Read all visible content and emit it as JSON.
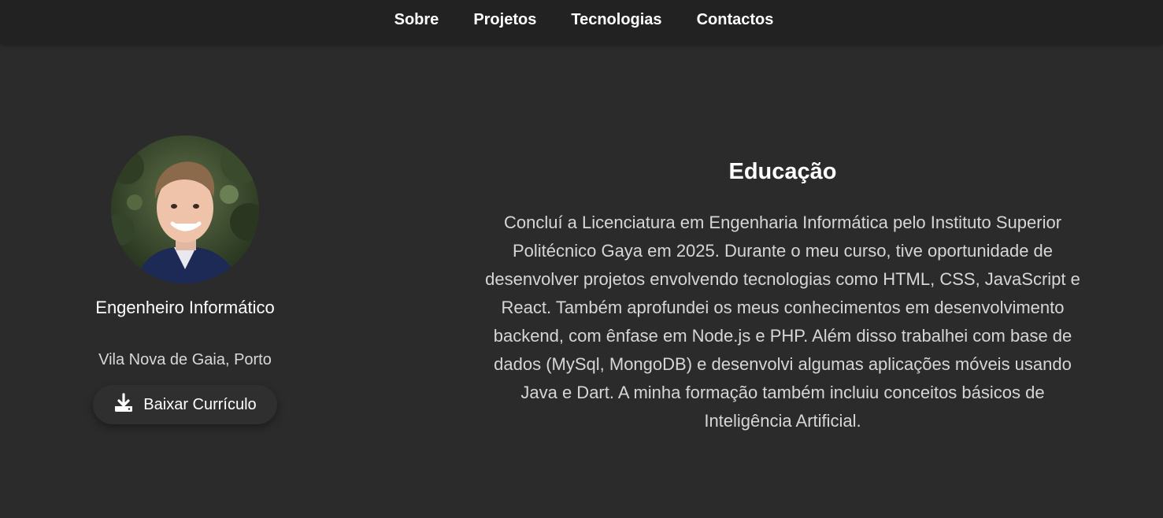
{
  "nav": {
    "items": [
      {
        "label": "Sobre"
      },
      {
        "label": "Projetos"
      },
      {
        "label": "Tecnologias"
      },
      {
        "label": "Contactos"
      }
    ]
  },
  "profile": {
    "role": "Engenheiro Informático",
    "location": "Vila Nova de Gaia, Porto",
    "cv_button_label": "Baixar Currículo",
    "cv_icon": "download-icon"
  },
  "education": {
    "title": "Educação",
    "text": "Concluí a Licenciatura em Engenharia Informática pelo Instituto Superior Politécnico Gaya em 2025. Durante o meu curso, tive oportunidade de desenvolver projetos envolvendo tecnologias como HTML, CSS, JavaScript e React. Também aprofundei os meus conhecimentos em desenvolvimento backend, com ênfase em Node.js e PHP. Além disso trabalhei com base de dados (MySql, MongoDB) e desenvolvi algumas aplicações móveis usando Java e Dart. A minha formação também incluiu conceitos básicos de Inteligência Artificial."
  },
  "colors": {
    "background": "#2b2b2b",
    "navbar": "#222222",
    "text": "#ffffff",
    "muted_text": "#d6d6d6"
  }
}
